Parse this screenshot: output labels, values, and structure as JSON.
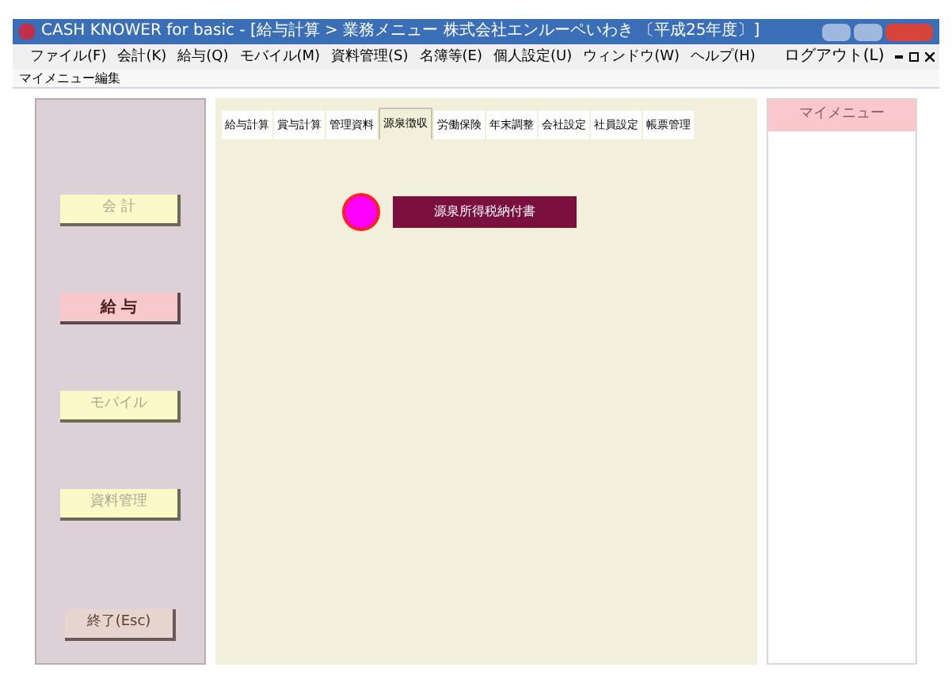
{
  "window": {
    "title": "CASH KNOWER for basic - [給与計算 > 業務メニュー 株式会社エンルーペいわき 〔平成25年度〕]"
  },
  "menu": [
    "ファイル(F)",
    "会計(K)",
    "給与(Q)",
    "モバイル(M)",
    "資料管理(S)",
    "名簿等(E)",
    "個人設定(U)",
    "ウィンドウ(W)",
    "ヘルプ(H)"
  ],
  "logout": "ログアウト(L)",
  "toolbar_label": "マイメニュー編集",
  "sidebar": {
    "items": [
      {
        "label": "会 計",
        "selected": false
      },
      {
        "label": "給 与",
        "selected": true
      },
      {
        "label": "モバイル",
        "selected": false
      },
      {
        "label": "資料管理",
        "selected": false
      }
    ],
    "exit": "終了(Esc)"
  },
  "tabs": [
    {
      "label": "給与計算",
      "selected": false
    },
    {
      "label": "賞与計算",
      "selected": false
    },
    {
      "label": "管理資料",
      "selected": false
    },
    {
      "label": "源泉徴収",
      "selected": true
    },
    {
      "label": "労働保険",
      "selected": false
    },
    {
      "label": "年末調整",
      "selected": false
    },
    {
      "label": "会社設定",
      "selected": false
    },
    {
      "label": "社員設定",
      "selected": false
    },
    {
      "label": "帳票管理",
      "selected": false
    }
  ],
  "actions": [
    {
      "label": "源泉所得税納付書",
      "color": "#ff00ff"
    }
  ],
  "my_menu": {
    "title": "マイメニュー"
  }
}
